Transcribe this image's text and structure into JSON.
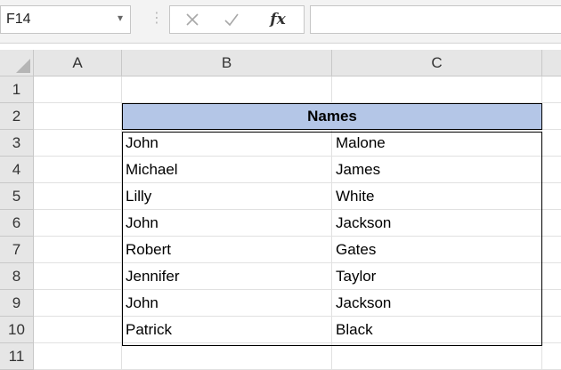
{
  "name_box": {
    "value": "F14",
    "dropdown_icon": "chevron-down-icon"
  },
  "formula_bar": {
    "cancel_icon": "close-icon",
    "enter_icon": "check-icon",
    "fx_label": "fx",
    "value": ""
  },
  "columns": [
    "A",
    "B",
    "C"
  ],
  "rows": [
    "1",
    "2",
    "3",
    "4",
    "5",
    "6",
    "7",
    "8",
    "9",
    "10",
    "11"
  ],
  "table": {
    "header": "Names",
    "header_color": "#b4c6e7",
    "records": [
      {
        "first": "John",
        "last": "Malone"
      },
      {
        "first": "Michael",
        "last": "James"
      },
      {
        "first": "Lilly",
        "last": "White"
      },
      {
        "first": "John",
        "last": "Jackson"
      },
      {
        "first": "Robert",
        "last": "Gates"
      },
      {
        "first": "Jennifer",
        "last": "Taylor"
      },
      {
        "first": "John",
        "last": "Jackson"
      },
      {
        "first": "Patrick",
        "last": "Black"
      }
    ]
  }
}
